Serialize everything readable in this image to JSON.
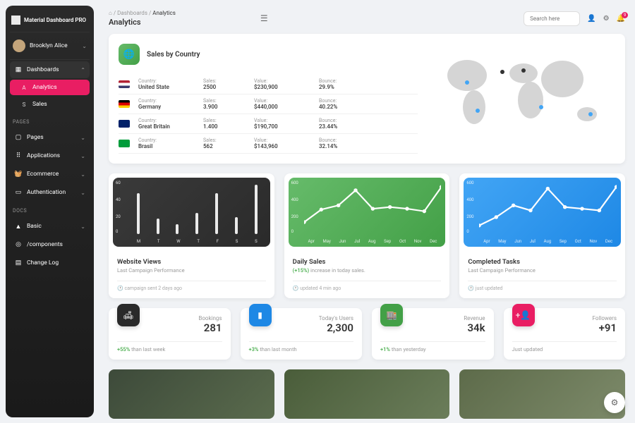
{
  "brand": "Material Dashboard PRO",
  "user": {
    "name": "Brooklyn Alice"
  },
  "nav": {
    "dashboards": "Dashboards",
    "analytics": "Analytics",
    "sales": "Sales",
    "pages_section": "PAGES",
    "pages": "Pages",
    "applications": "Applications",
    "ecommerce": "Ecommerce",
    "authentication": "Authentication",
    "docs_section": "DOCS",
    "basic": "Basic",
    "components": "/components",
    "changelog": "Change Log"
  },
  "breadcrumb": {
    "root": "Dashboards",
    "current": "Analytics"
  },
  "page_title": "Analytics",
  "search": {
    "placeholder": "Search here"
  },
  "notifications": "9",
  "country_card": {
    "title": "Sales by Country",
    "headers": {
      "country": "Country:",
      "sales": "Sales:",
      "value": "Value:",
      "bounce": "Bounce:"
    },
    "rows": [
      {
        "name": "United State",
        "sales": "2500",
        "value": "$230,900",
        "bounce": "29.9%"
      },
      {
        "name": "Germany",
        "sales": "3.900",
        "value": "$440,000",
        "bounce": "40.22%"
      },
      {
        "name": "Great Britain",
        "sales": "1.400",
        "value": "$190,700",
        "bounce": "23.44%"
      },
      {
        "name": "Brasil",
        "sales": "562",
        "value": "$143,960",
        "bounce": "32.14%"
      }
    ]
  },
  "chart_data": [
    {
      "type": "bar",
      "title": "Website Views",
      "subtitle": "Last Campaign Performance",
      "meta": "campaign sent 2 days ago",
      "categories": [
        "M",
        "T",
        "W",
        "T",
        "F",
        "S",
        "S"
      ],
      "values": [
        48,
        18,
        12,
        25,
        48,
        20,
        58
      ],
      "ylim": [
        0,
        60
      ],
      "yticks": [
        60,
        40,
        20,
        0
      ]
    },
    {
      "type": "line",
      "title": "Daily Sales",
      "subtitle_prefix": "(+15%)",
      "subtitle_rest": " increase in today sales.",
      "meta": "updated 4 min ago",
      "categories": [
        "Apr",
        "May",
        "Jun",
        "Jul",
        "Aug",
        "Sep",
        "Oct",
        "Nov",
        "Dec"
      ],
      "values": [
        120,
        270,
        320,
        500,
        280,
        300,
        280,
        250,
        540
      ],
      "ylim": [
        0,
        600
      ],
      "yticks": [
        600,
        400,
        200,
        0
      ]
    },
    {
      "type": "line",
      "title": "Completed Tasks",
      "subtitle": "Last Campaign Performance",
      "meta": "just updated",
      "categories": [
        "Apr",
        "May",
        "Jun",
        "Jul",
        "Aug",
        "Sep",
        "Oct",
        "Nov",
        "Dec"
      ],
      "values": [
        80,
        180,
        320,
        260,
        520,
        300,
        280,
        260,
        540
      ],
      "ylim": [
        0,
        600
      ],
      "yticks": [
        600,
        400,
        200,
        0
      ]
    }
  ],
  "stats": [
    {
      "label": "Bookings",
      "value": "281",
      "change_pct": "+55%",
      "change_rest": " than last week"
    },
    {
      "label": "Today's Users",
      "value": "2,300",
      "change_pct": "+3%",
      "change_rest": " than last month"
    },
    {
      "label": "Revenue",
      "value": "34k",
      "change_pct": "+1%",
      "change_rest": " than yesterday"
    },
    {
      "label": "Followers",
      "value": "+91",
      "change_text": "Just updated"
    }
  ]
}
